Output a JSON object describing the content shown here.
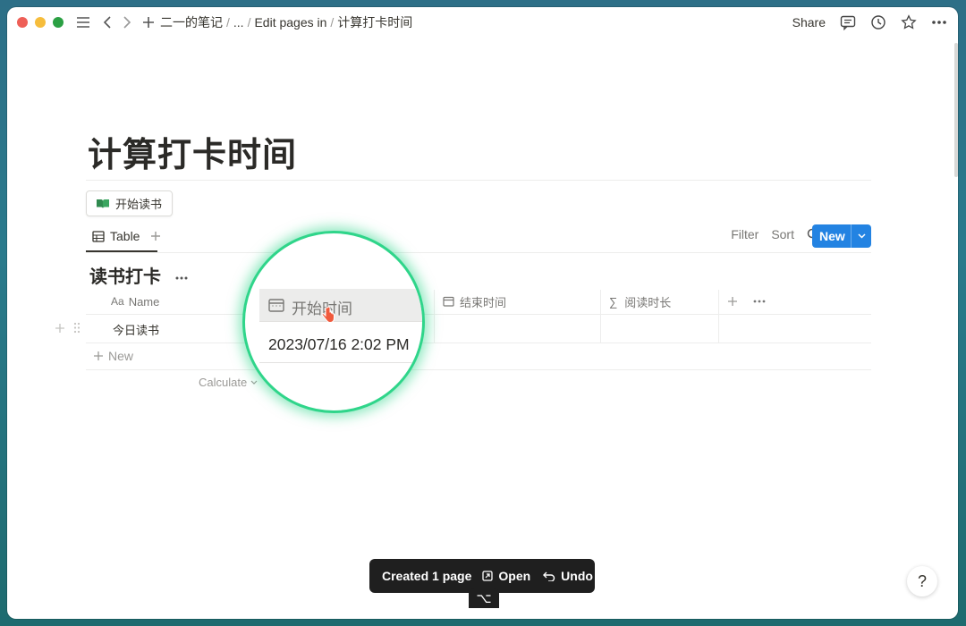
{
  "breadcrumb": {
    "workspace": "二一的笔记",
    "ellipsis": "...",
    "parent": "Edit pages in",
    "current": "计算打卡时间"
  },
  "topbar": {
    "share": "Share"
  },
  "page": {
    "title": "计算打卡时间",
    "button_label": "开始读书"
  },
  "view": {
    "tab_label": "Table",
    "filter": "Filter",
    "sort": "Sort",
    "new_label": "New"
  },
  "database": {
    "title": "读书打卡",
    "columns": {
      "name": "Name",
      "name_prefix": "Aa",
      "start": "开始时间",
      "end": "结束时间",
      "duration": "阅读时长"
    },
    "rows": [
      {
        "name": "今日读书",
        "start": "2023/07/16 2:02 PM",
        "end": "",
        "duration": ""
      }
    ],
    "add_row": "New",
    "calculate": "Calculate"
  },
  "toast": {
    "message": "Created 1 page",
    "open": "Open",
    "undo": "Undo"
  },
  "shortcut_key": "⌥",
  "help": "?",
  "colors": {
    "accent": "#2383e2",
    "highlight": "#2fd58a",
    "close": "#ee5f57",
    "minimize": "#f6bd3c",
    "zoom": "#2ba043"
  }
}
